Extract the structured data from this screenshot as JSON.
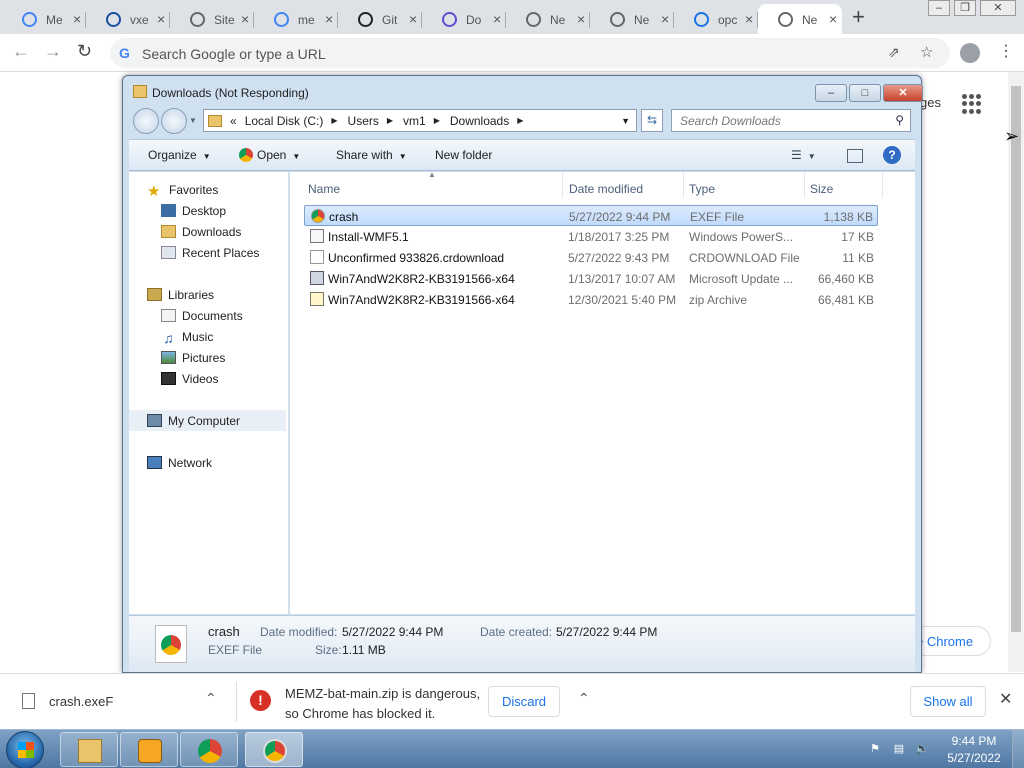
{
  "browser": {
    "tabs": [
      {
        "title": "Me",
        "favicon": "google-icon",
        "color": "#4285f4"
      },
      {
        "title": "vxe",
        "favicon": "s-icon",
        "color": "#1a4fa0"
      },
      {
        "title": "Site",
        "favicon": "globe-icon",
        "color": "#666666"
      },
      {
        "title": "me",
        "favicon": "google-icon",
        "color": "#4285f4"
      },
      {
        "title": "Git",
        "favicon": "github-icon",
        "color": "#222222"
      },
      {
        "title": "Do",
        "favicon": "doc-icon",
        "color": "#5a4fcf"
      },
      {
        "title": "Ne",
        "favicon": "chrome-icon",
        "color": "#666666"
      },
      {
        "title": "Ne",
        "favicon": "chrome-icon",
        "color": "#666666"
      },
      {
        "title": "opc",
        "favicon": "search-icon",
        "color": "#1a73e8"
      },
      {
        "title": "Ne",
        "favicon": "chrome-icon",
        "color": "#666666",
        "active": true
      }
    ],
    "new_tab": "+",
    "omnibox_placeholder": "Search Google or type a URL",
    "page_partial_text": "ges",
    "page_button_text": "e Chrome"
  },
  "explorer": {
    "title": "Downloads (Not Responding)",
    "breadcrumb": [
      "Local Disk (C:)",
      "Users",
      "vm1",
      "Downloads"
    ],
    "search_placeholder": "Search Downloads",
    "toolbar": {
      "organize": "Organize",
      "open": "Open",
      "share_with": "Share with",
      "new_folder": "New folder"
    },
    "nav": {
      "favorites": "Favorites",
      "favorites_items": [
        "Desktop",
        "Downloads",
        "Recent Places"
      ],
      "libraries": "Libraries",
      "libraries_items": [
        "Documents",
        "Music",
        "Pictures",
        "Videos"
      ],
      "my_computer": "My Computer",
      "network": "Network"
    },
    "columns": {
      "name": "Name",
      "date": "Date modified",
      "type": "Type",
      "size": "Size"
    },
    "files": [
      {
        "name": "crash",
        "date": "5/27/2022 9:44 PM",
        "type": "EXEF File",
        "size": "1,138 KB",
        "selected": true
      },
      {
        "name": "Install-WMF5.1",
        "date": "1/18/2017 3:25 PM",
        "type": "Windows PowerS...",
        "size": "17 KB"
      },
      {
        "name": "Unconfirmed 933826.crdownload",
        "date": "5/27/2022 9:43 PM",
        "type": "CRDOWNLOAD File",
        "size": "11 KB"
      },
      {
        "name": "Win7AndW2K8R2-KB3191566-x64",
        "date": "1/13/2017 10:07 AM",
        "type": "Microsoft Update ...",
        "size": "66,460 KB"
      },
      {
        "name": "Win7AndW2K8R2-KB3191566-x64",
        "date": "12/30/2021 5:40 PM",
        "type": "zip Archive",
        "size": "66,481 KB"
      }
    ],
    "details": {
      "name": "crash",
      "type": "EXEF File",
      "date_modified_label": "Date modified:",
      "date_modified": "5/27/2022 9:44 PM",
      "date_created_label": "Date created:",
      "date_created": "5/27/2022 9:44 PM",
      "size_label": "Size:",
      "size": "1.11 MB"
    }
  },
  "download_shelf": {
    "file": "crash.exeF",
    "warning_line1": "MEMZ-bat-main.zip is dangerous,",
    "warning_line2": "so Chrome has blocked it.",
    "discard": "Discard",
    "show_all": "Show all"
  },
  "taskbar": {
    "time": "9:44 PM",
    "date": "5/27/2022"
  }
}
